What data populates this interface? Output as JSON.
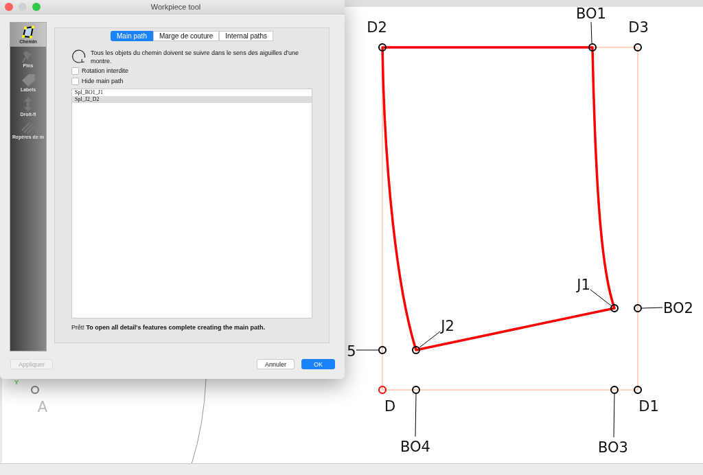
{
  "window": {
    "title": "Workpiece tool"
  },
  "sidebar": {
    "items": [
      {
        "label": "Chemin",
        "kind": "path",
        "selected": true
      },
      {
        "label": "Pins",
        "kind": "pin",
        "selected": false
      },
      {
        "label": "Labels",
        "kind": "tag",
        "selected": false
      },
      {
        "label": "Droit-fi",
        "kind": "grain",
        "selected": false
      },
      {
        "label": "Repères de m",
        "kind": "hatch",
        "selected": false
      }
    ]
  },
  "tabs": [
    {
      "label": "Main path",
      "selected": true
    },
    {
      "label": "Marge de couture",
      "selected": false
    },
    {
      "label": "Internal paths",
      "selected": false
    }
  ],
  "hint": "Tous les objets du chemin doivent se suivre dans le sens des aiguilles d'une montre.",
  "checkboxes": [
    {
      "label": "Rotation interdite",
      "checked": false
    },
    {
      "label": "Hide main path",
      "checked": false
    }
  ],
  "path_list": [
    {
      "label": "Spl_BO1_J1",
      "selected": false
    },
    {
      "label": "Spl_J2_D2",
      "selected": true
    }
  ],
  "status": "Prêt! **To open all detail's features complete creating the main path.**",
  "buttons": {
    "apply": {
      "label": "Appliquer",
      "disabled": true
    },
    "cancel": {
      "label": "Annuler"
    },
    "ok": {
      "label": "OK"
    }
  },
  "canvas": {
    "axis_label": "Y",
    "points": [
      {
        "label": "A",
        "color": "#808080"
      },
      {
        "label": "D2",
        "color": "#000000"
      },
      {
        "label": "BO1",
        "color": "#000000"
      },
      {
        "label": "D3",
        "color": "#000000"
      },
      {
        "label": "J1",
        "color": "#000000"
      },
      {
        "label": "BO2",
        "color": "#000000"
      },
      {
        "label": "J2",
        "color": "#000000"
      },
      {
        "label": "5",
        "color": "#000000"
      },
      {
        "label": "D",
        "color": "#ff0000"
      },
      {
        "label": "BO4",
        "color": "#000000"
      },
      {
        "label": "BO3",
        "color": "#000000"
      },
      {
        "label": "D1",
        "color": "#000000"
      }
    ]
  }
}
